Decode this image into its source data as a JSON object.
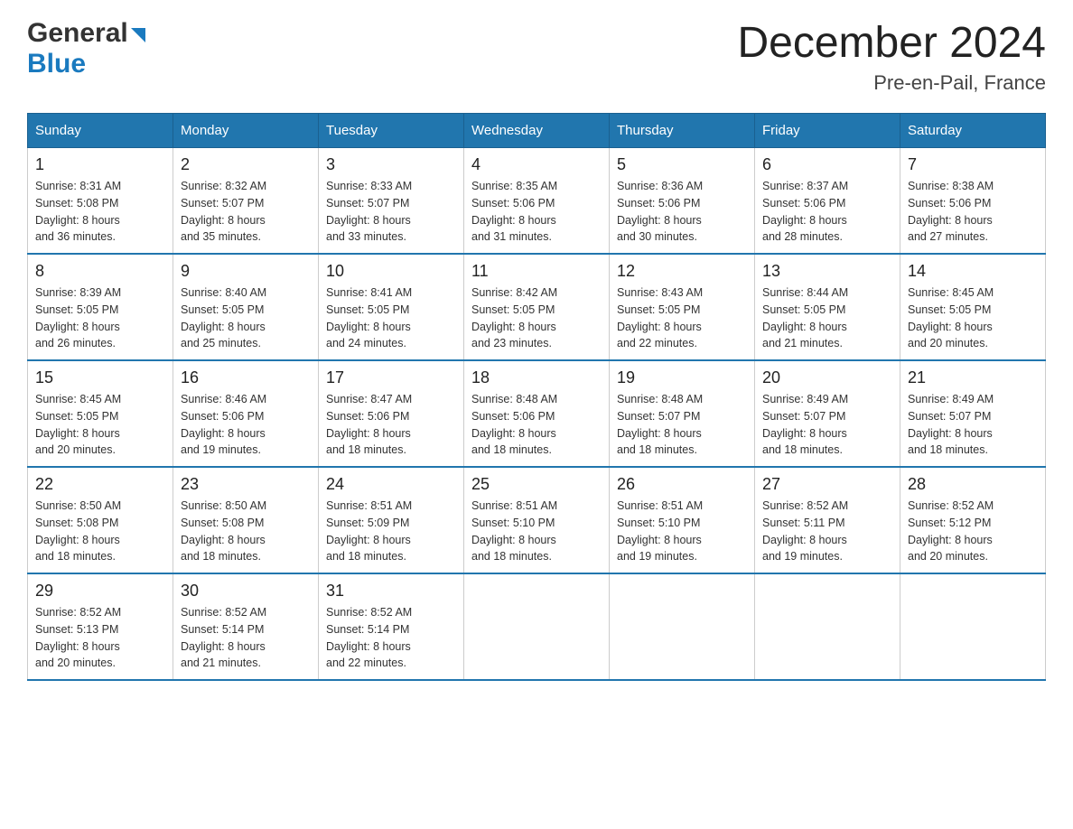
{
  "header": {
    "logo": {
      "general": "General",
      "blue": "Blue",
      "arrow": "▶"
    },
    "title": "December 2024",
    "subtitle": "Pre-en-Pail, France"
  },
  "days_header": [
    "Sunday",
    "Monday",
    "Tuesday",
    "Wednesday",
    "Thursday",
    "Friday",
    "Saturday"
  ],
  "weeks": [
    [
      {
        "day": "1",
        "sunrise": "8:31 AM",
        "sunset": "5:08 PM",
        "daylight": "8 hours and 36 minutes."
      },
      {
        "day": "2",
        "sunrise": "8:32 AM",
        "sunset": "5:07 PM",
        "daylight": "8 hours and 35 minutes."
      },
      {
        "day": "3",
        "sunrise": "8:33 AM",
        "sunset": "5:07 PM",
        "daylight": "8 hours and 33 minutes."
      },
      {
        "day": "4",
        "sunrise": "8:35 AM",
        "sunset": "5:06 PM",
        "daylight": "8 hours and 31 minutes."
      },
      {
        "day": "5",
        "sunrise": "8:36 AM",
        "sunset": "5:06 PM",
        "daylight": "8 hours and 30 minutes."
      },
      {
        "day": "6",
        "sunrise": "8:37 AM",
        "sunset": "5:06 PM",
        "daylight": "8 hours and 28 minutes."
      },
      {
        "day": "7",
        "sunrise": "8:38 AM",
        "sunset": "5:06 PM",
        "daylight": "8 hours and 27 minutes."
      }
    ],
    [
      {
        "day": "8",
        "sunrise": "8:39 AM",
        "sunset": "5:05 PM",
        "daylight": "8 hours and 26 minutes."
      },
      {
        "day": "9",
        "sunrise": "8:40 AM",
        "sunset": "5:05 PM",
        "daylight": "8 hours and 25 minutes."
      },
      {
        "day": "10",
        "sunrise": "8:41 AM",
        "sunset": "5:05 PM",
        "daylight": "8 hours and 24 minutes."
      },
      {
        "day": "11",
        "sunrise": "8:42 AM",
        "sunset": "5:05 PM",
        "daylight": "8 hours and 23 minutes."
      },
      {
        "day": "12",
        "sunrise": "8:43 AM",
        "sunset": "5:05 PM",
        "daylight": "8 hours and 22 minutes."
      },
      {
        "day": "13",
        "sunrise": "8:44 AM",
        "sunset": "5:05 PM",
        "daylight": "8 hours and 21 minutes."
      },
      {
        "day": "14",
        "sunrise": "8:45 AM",
        "sunset": "5:05 PM",
        "daylight": "8 hours and 20 minutes."
      }
    ],
    [
      {
        "day": "15",
        "sunrise": "8:45 AM",
        "sunset": "5:05 PM",
        "daylight": "8 hours and 20 minutes."
      },
      {
        "day": "16",
        "sunrise": "8:46 AM",
        "sunset": "5:06 PM",
        "daylight": "8 hours and 19 minutes."
      },
      {
        "day": "17",
        "sunrise": "8:47 AM",
        "sunset": "5:06 PM",
        "daylight": "8 hours and 18 minutes."
      },
      {
        "day": "18",
        "sunrise": "8:48 AM",
        "sunset": "5:06 PM",
        "daylight": "8 hours and 18 minutes."
      },
      {
        "day": "19",
        "sunrise": "8:48 AM",
        "sunset": "5:07 PM",
        "daylight": "8 hours and 18 minutes."
      },
      {
        "day": "20",
        "sunrise": "8:49 AM",
        "sunset": "5:07 PM",
        "daylight": "8 hours and 18 minutes."
      },
      {
        "day": "21",
        "sunrise": "8:49 AM",
        "sunset": "5:07 PM",
        "daylight": "8 hours and 18 minutes."
      }
    ],
    [
      {
        "day": "22",
        "sunrise": "8:50 AM",
        "sunset": "5:08 PM",
        "daylight": "8 hours and 18 minutes."
      },
      {
        "day": "23",
        "sunrise": "8:50 AM",
        "sunset": "5:08 PM",
        "daylight": "8 hours and 18 minutes."
      },
      {
        "day": "24",
        "sunrise": "8:51 AM",
        "sunset": "5:09 PM",
        "daylight": "8 hours and 18 minutes."
      },
      {
        "day": "25",
        "sunrise": "8:51 AM",
        "sunset": "5:10 PM",
        "daylight": "8 hours and 18 minutes."
      },
      {
        "day": "26",
        "sunrise": "8:51 AM",
        "sunset": "5:10 PM",
        "daylight": "8 hours and 19 minutes."
      },
      {
        "day": "27",
        "sunrise": "8:52 AM",
        "sunset": "5:11 PM",
        "daylight": "8 hours and 19 minutes."
      },
      {
        "day": "28",
        "sunrise": "8:52 AM",
        "sunset": "5:12 PM",
        "daylight": "8 hours and 20 minutes."
      }
    ],
    [
      {
        "day": "29",
        "sunrise": "8:52 AM",
        "sunset": "5:13 PM",
        "daylight": "8 hours and 20 minutes."
      },
      {
        "day": "30",
        "sunrise": "8:52 AM",
        "sunset": "5:14 PM",
        "daylight": "8 hours and 21 minutes."
      },
      {
        "day": "31",
        "sunrise": "8:52 AM",
        "sunset": "5:14 PM",
        "daylight": "8 hours and 22 minutes."
      },
      null,
      null,
      null,
      null
    ]
  ]
}
